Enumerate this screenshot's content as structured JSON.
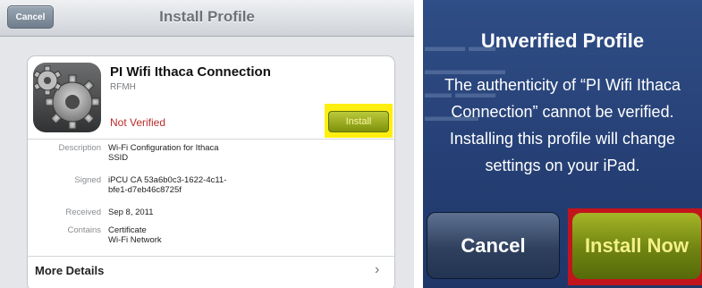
{
  "install_screen": {
    "cancel_label": "Cancel",
    "title": "Install Profile",
    "profile": {
      "name": "PI Wifi Ithaca Connection",
      "organization": "RFMH",
      "status": "Not Verified",
      "install_label": "Install"
    },
    "details": [
      {
        "label": "Description",
        "value_lines": [
          "Wi-Fi Configuration for Ithaca",
          "SSID"
        ]
      },
      {
        "label": "Signed",
        "value_lines": [
          "iPCU CA 53a6b0c3-1622-4c11-",
          "bfe1-d7eb46c8725f"
        ]
      },
      {
        "label": "Received",
        "value_lines": [
          "Sep 8, 2011"
        ]
      },
      {
        "label": "Contains",
        "value_lines": [
          "Certificate",
          "Wi-Fi Network"
        ]
      }
    ],
    "more_details_label": "More Details",
    "chevron": "›",
    "icon": "gear-icon"
  },
  "alert": {
    "title": "Unverified Profile",
    "message_lines": [
      "The authenticity of “PI Wifi Ithaca",
      "Connection” cannot be verified.",
      "Installing this profile will change",
      "settings on your iPad."
    ],
    "cancel_label": "Cancel",
    "install_now_label": "Install Now"
  },
  "colors": {
    "highlight_yellow": "#ffef10",
    "highlight_red": "#c2141c",
    "install_green": "#8fa01a",
    "not_verified_red": "#b92b2b",
    "alert_blue": "#2a467d"
  }
}
